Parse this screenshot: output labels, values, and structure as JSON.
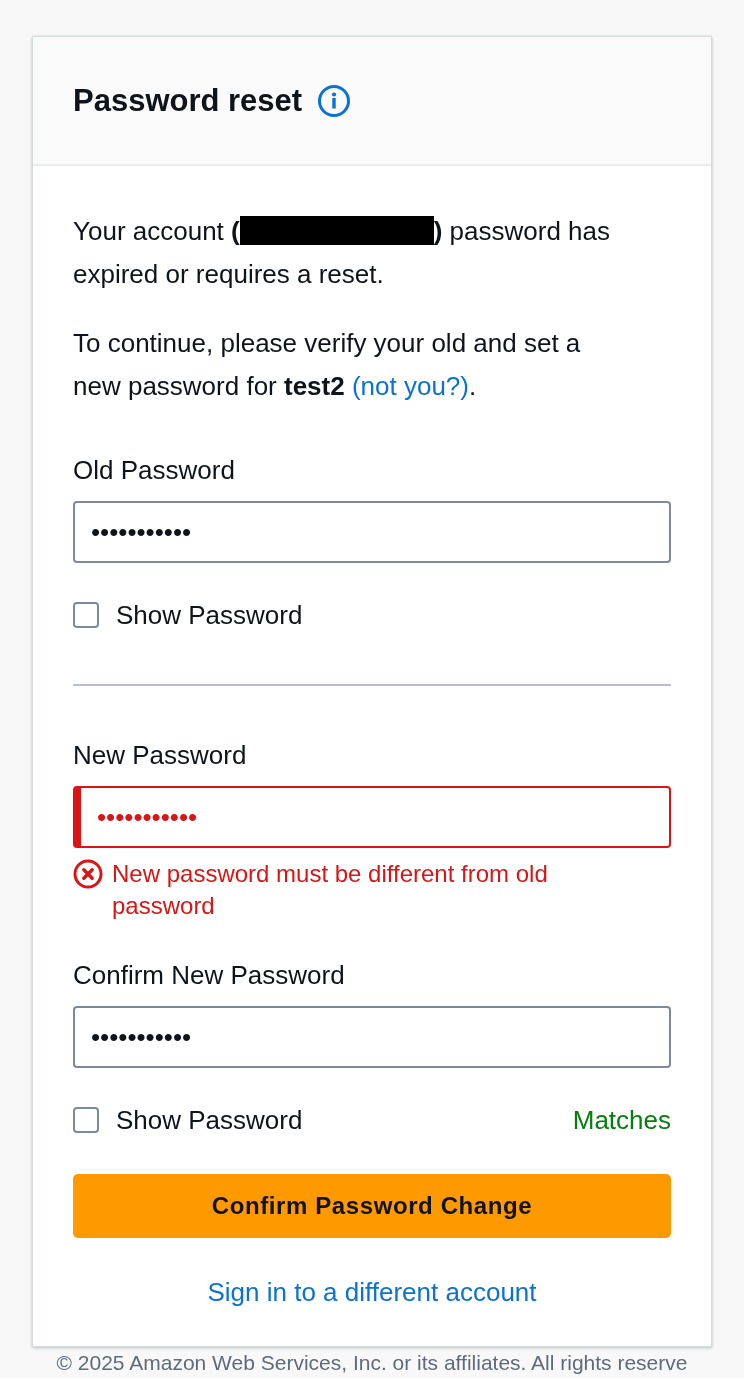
{
  "header": {
    "title": "Password reset"
  },
  "intro": {
    "before": "Your account **(**",
    "account_redacted": true,
    "after": "**)** password has expired or requires a reset."
  },
  "instructions": {
    "before": "To continue, please verify your old and set a new password for **test2** ",
    "link": "(not you?)",
    "after": "."
  },
  "old_password": {
    "label": "Old Password",
    "value": "•••••••••••",
    "invalid": false,
    "show_password": {
      "label": "Show Password",
      "checked": false
    }
  },
  "new_passwords": [
    {
      "label": "New Password",
      "value": "•••••••••••",
      "invalid": true,
      "error": "New password must be different from old password"
    },
    {
      "label": "Confirm New Password",
      "value": "•••••••••••",
      "invalid": false,
      "show_password": {
        "label": "Show Password",
        "checked": false
      },
      "match_status": "Matches"
    }
  ],
  "submit_button": "Confirm Password Change",
  "switch_account_link": "Sign in to a different account",
  "footer": "© 2025 Amazon Web Services, Inc. or its affiliates. All rights reserve"
}
